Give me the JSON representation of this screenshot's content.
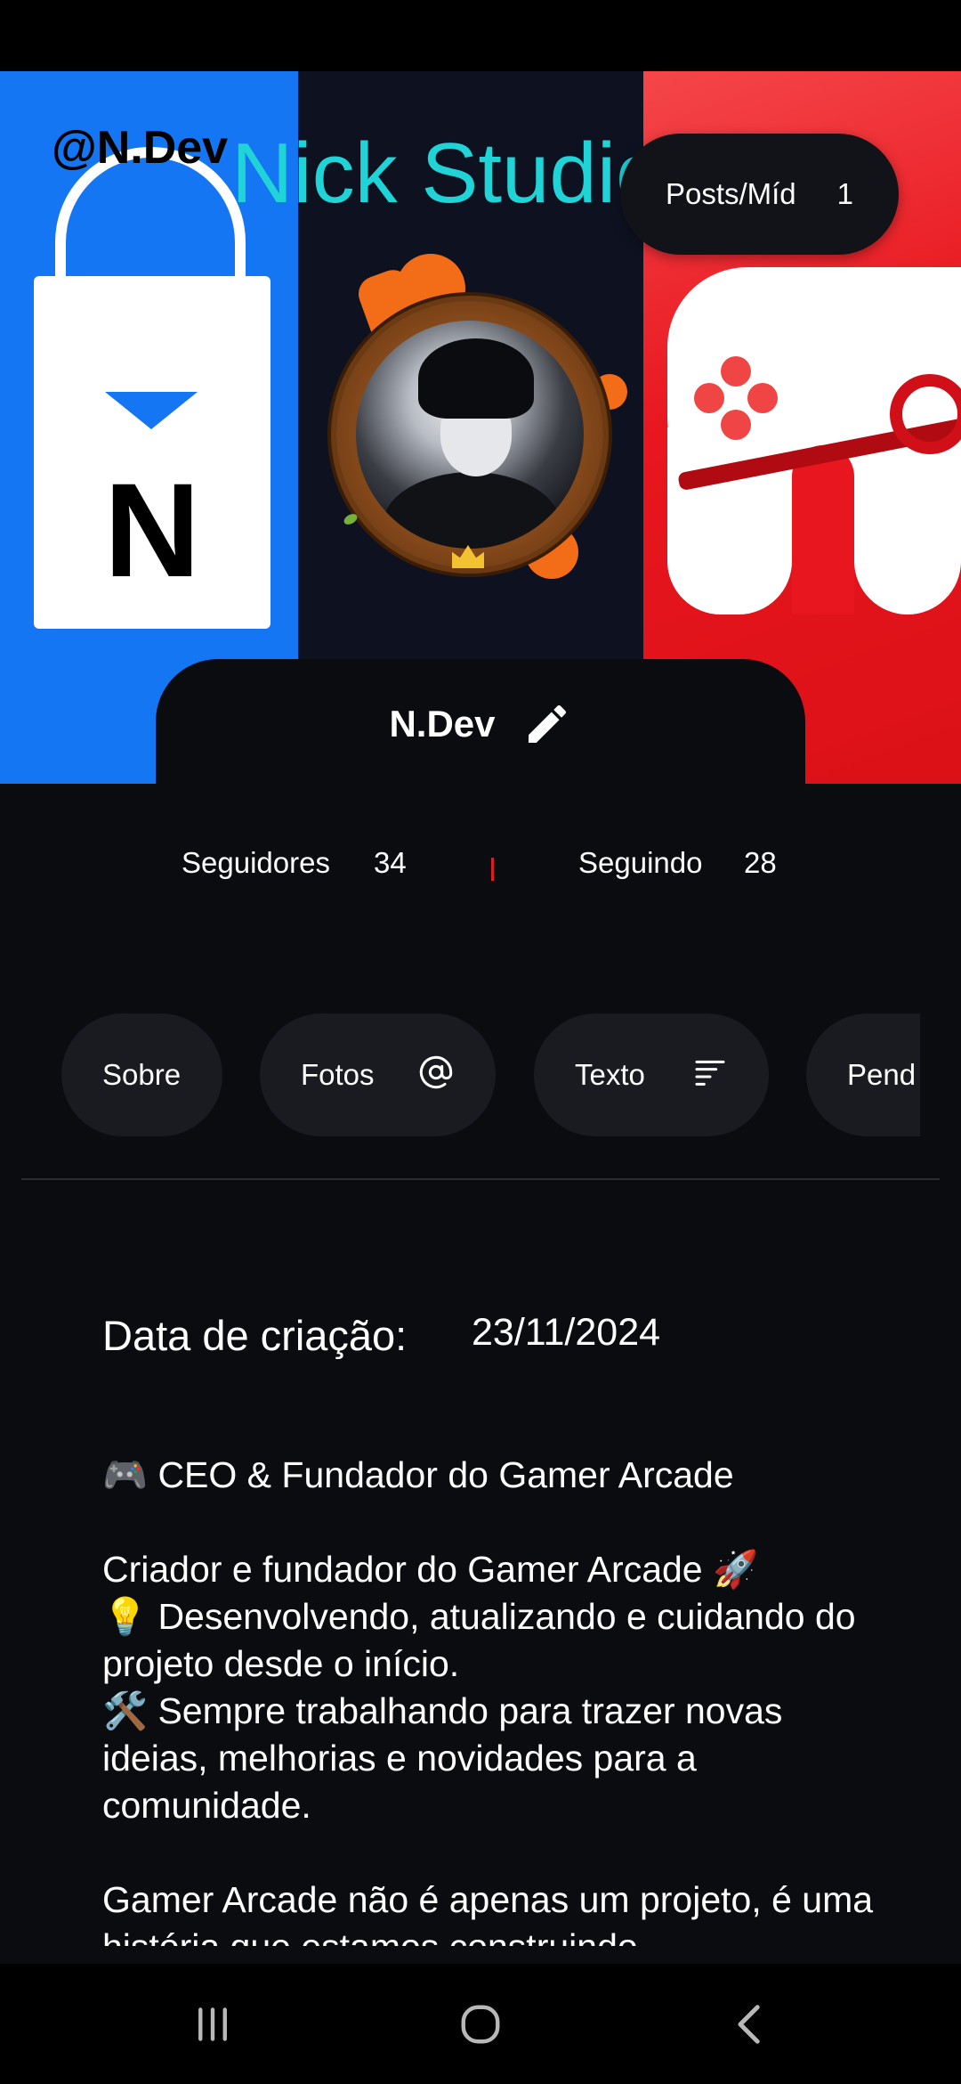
{
  "banner": {
    "handle": "@N.Dev",
    "studio_text": "Nick Studio",
    "logo_letter": "N"
  },
  "posts_pill": {
    "label": "Posts/Míd",
    "count": "1"
  },
  "profile": {
    "name": "N.Dev"
  },
  "stats": {
    "followers_label": "Seguidores",
    "followers_count": "34",
    "following_label": "Seguindo",
    "following_count": "28"
  },
  "tabs": [
    {
      "label": "Sobre",
      "icon": ""
    },
    {
      "label": "Fotos",
      "icon": "at-sign-icon"
    },
    {
      "label": "Texto",
      "icon": "text-lines-icon"
    },
    {
      "label": "Pend",
      "icon": ""
    }
  ],
  "details": {
    "created_label": "Data de criação:",
    "created_value": "23/11/2024"
  },
  "bio": {
    "text": "🎮 CEO & Fundador do Gamer Arcade\n\nCriador e fundador do Gamer Arcade 🚀\n💡 Desenvolvendo, atualizando e cuidando do projeto desde o início.\n🛠️ Sempre trabalhando para trazer novas ideias, melhorias e novidades para a comunidade.\n\nGamer Arcade não é apenas um projeto, é uma história que estamos construindo"
  },
  "colors": {
    "background": "#0b0c10",
    "surface": "#1a1b20",
    "banner_blue": "#1476f2",
    "banner_red": "#e8161e",
    "studio_cyan": "#1fd3d6",
    "divider_red": "#d81f26"
  }
}
